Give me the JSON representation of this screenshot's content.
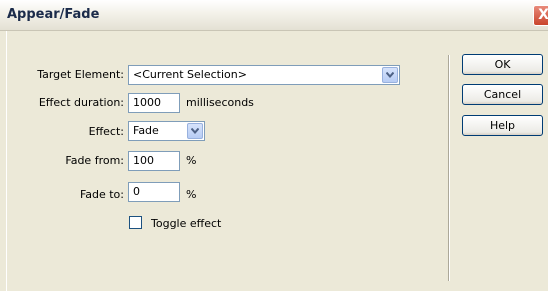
{
  "window": {
    "title": "Appear/Fade",
    "close_label": "X"
  },
  "form": {
    "target_element": {
      "label": "Target Element:",
      "value": "<Current Selection>"
    },
    "effect_duration": {
      "label": "Effect duration:",
      "value": "1000",
      "unit": "milliseconds"
    },
    "effect": {
      "label": "Effect:",
      "value": "Fade"
    },
    "fade_from": {
      "label": "Fade from:",
      "value": "100",
      "unit": "%"
    },
    "fade_to": {
      "label": "Fade to:",
      "value": "0",
      "unit": "%"
    },
    "toggle_effect": {
      "label": "Toggle effect",
      "checked": false
    }
  },
  "buttons": {
    "ok": "OK",
    "cancel": "Cancel",
    "help": "Help"
  }
}
